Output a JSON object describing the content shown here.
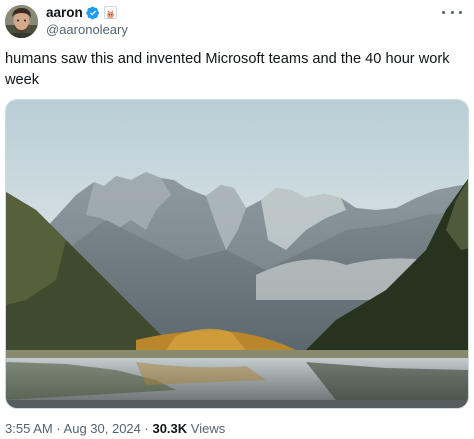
{
  "author": {
    "display_name": "aaron",
    "handle": "@aaronoleary",
    "avatar_icon": "avatar-photo",
    "verified_icon": "verified-badge-icon",
    "verified_color": "#1d9bf0",
    "affiliate_icon": "affiliate-badge-icon"
  },
  "tweet": {
    "text": "humans saw this and invented Microsoft teams and the 40 hour work week",
    "media_description_icon": "mountain-lake-photo"
  },
  "meta": {
    "time": "3:55 AM",
    "separator1": " · ",
    "date": "Aug 30, 2024",
    "separator2": " · ",
    "views_count": "30.3K",
    "views_label": " Views"
  },
  "colors": {
    "text_primary": "#0f1419",
    "text_secondary": "#536471",
    "border": "#cfd9de"
  }
}
